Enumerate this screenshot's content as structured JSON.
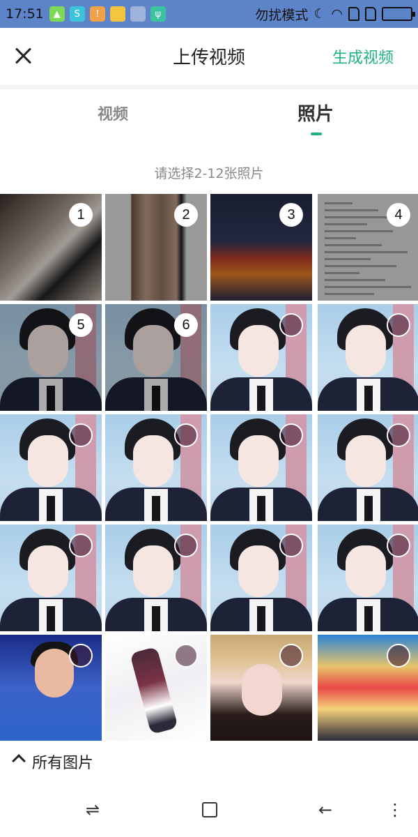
{
  "status_bar": {
    "time": "17:51",
    "dnd_label": "勿扰模式",
    "apps": [
      {
        "icon": "android-app-icon",
        "color": "#7ed957"
      },
      {
        "icon": "swirl-app-icon",
        "color": "#3cc2d9"
      },
      {
        "icon": "warning-icon",
        "color": "#f0a14a"
      },
      {
        "icon": "folder-icon",
        "color": "#f5c542"
      },
      {
        "icon": "clean-brush-icon",
        "color": "#9db3d9"
      },
      {
        "icon": "usb-icon",
        "color": "#3cc2a0"
      }
    ]
  },
  "header": {
    "title": "上传视频",
    "action": "生成视频"
  },
  "tabs": {
    "video": "视频",
    "photo": "照片",
    "active": "photo"
  },
  "hint": "请选择2-12张照片",
  "photos": [
    {
      "kind": "cat",
      "selected": true,
      "order": "1"
    },
    {
      "kind": "dress",
      "selected": true,
      "order": "2"
    },
    {
      "kind": "man",
      "selected": true,
      "order": "3"
    },
    {
      "kind": "doc",
      "selected": true,
      "order": "4"
    },
    {
      "kind": "face",
      "selected": true,
      "order": "5"
    },
    {
      "kind": "face",
      "selected": true,
      "order": "6"
    },
    {
      "kind": "face",
      "selected": false
    },
    {
      "kind": "face",
      "selected": false
    },
    {
      "kind": "face",
      "selected": false
    },
    {
      "kind": "face",
      "selected": false
    },
    {
      "kind": "face",
      "selected": false
    },
    {
      "kind": "face",
      "selected": false
    },
    {
      "kind": "face",
      "selected": false
    },
    {
      "kind": "face",
      "selected": false
    },
    {
      "kind": "face",
      "selected": false
    },
    {
      "kind": "face",
      "selected": false
    },
    {
      "kind": "blue",
      "selected": false
    },
    {
      "kind": "art",
      "selected": false
    },
    {
      "kind": "girl",
      "selected": false
    },
    {
      "kind": "anime",
      "selected": false
    }
  ],
  "album": {
    "label": "所有图片"
  },
  "accent_color": "#1fb47f"
}
